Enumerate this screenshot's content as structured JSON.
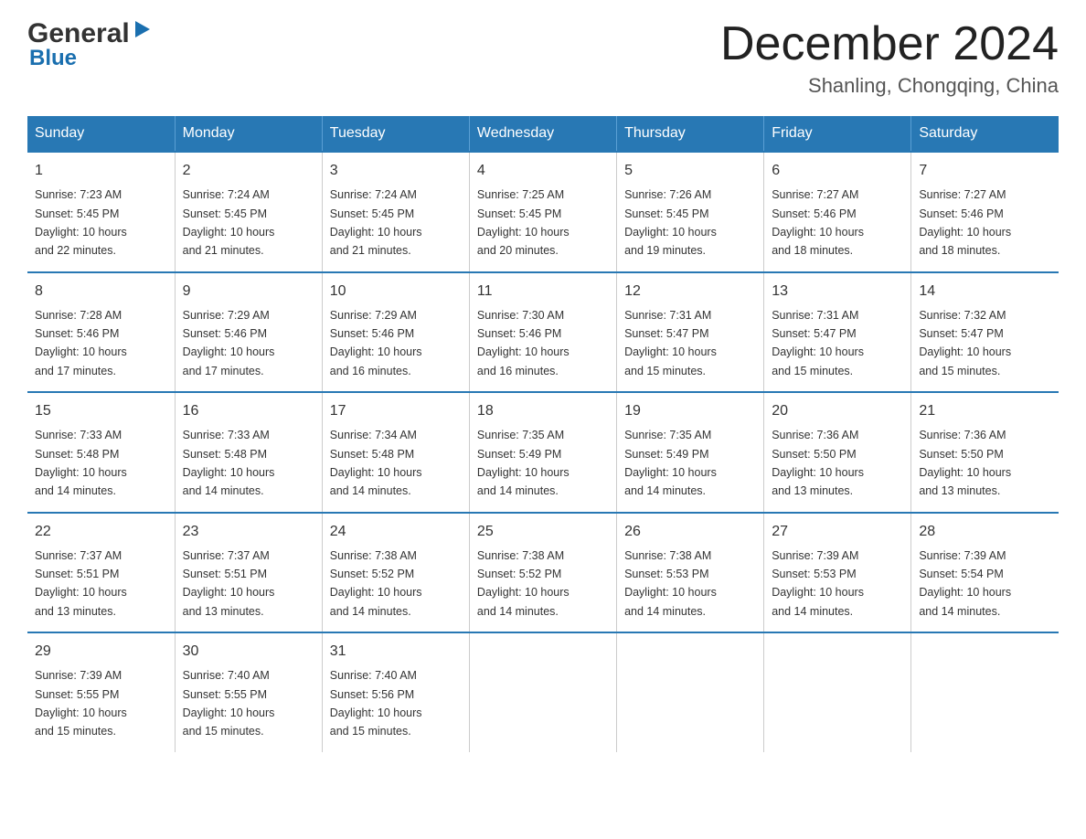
{
  "logo": {
    "general": "General",
    "blue": "Blue"
  },
  "title": "December 2024",
  "subtitle": "Shanling, Chongqing, China",
  "days": [
    "Sunday",
    "Monday",
    "Tuesday",
    "Wednesday",
    "Thursday",
    "Friday",
    "Saturday"
  ],
  "weeks": [
    [
      {
        "num": "1",
        "sunrise": "7:23 AM",
        "sunset": "5:45 PM",
        "daylight": "10 hours and 22 minutes."
      },
      {
        "num": "2",
        "sunrise": "7:24 AM",
        "sunset": "5:45 PM",
        "daylight": "10 hours and 21 minutes."
      },
      {
        "num": "3",
        "sunrise": "7:24 AM",
        "sunset": "5:45 PM",
        "daylight": "10 hours and 21 minutes."
      },
      {
        "num": "4",
        "sunrise": "7:25 AM",
        "sunset": "5:45 PM",
        "daylight": "10 hours and 20 minutes."
      },
      {
        "num": "5",
        "sunrise": "7:26 AM",
        "sunset": "5:45 PM",
        "daylight": "10 hours and 19 minutes."
      },
      {
        "num": "6",
        "sunrise": "7:27 AM",
        "sunset": "5:46 PM",
        "daylight": "10 hours and 18 minutes."
      },
      {
        "num": "7",
        "sunrise": "7:27 AM",
        "sunset": "5:46 PM",
        "daylight": "10 hours and 18 minutes."
      }
    ],
    [
      {
        "num": "8",
        "sunrise": "7:28 AM",
        "sunset": "5:46 PM",
        "daylight": "10 hours and 17 minutes."
      },
      {
        "num": "9",
        "sunrise": "7:29 AM",
        "sunset": "5:46 PM",
        "daylight": "10 hours and 17 minutes."
      },
      {
        "num": "10",
        "sunrise": "7:29 AM",
        "sunset": "5:46 PM",
        "daylight": "10 hours and 16 minutes."
      },
      {
        "num": "11",
        "sunrise": "7:30 AM",
        "sunset": "5:46 PM",
        "daylight": "10 hours and 16 minutes."
      },
      {
        "num": "12",
        "sunrise": "7:31 AM",
        "sunset": "5:47 PM",
        "daylight": "10 hours and 15 minutes."
      },
      {
        "num": "13",
        "sunrise": "7:31 AM",
        "sunset": "5:47 PM",
        "daylight": "10 hours and 15 minutes."
      },
      {
        "num": "14",
        "sunrise": "7:32 AM",
        "sunset": "5:47 PM",
        "daylight": "10 hours and 15 minutes."
      }
    ],
    [
      {
        "num": "15",
        "sunrise": "7:33 AM",
        "sunset": "5:48 PM",
        "daylight": "10 hours and 14 minutes."
      },
      {
        "num": "16",
        "sunrise": "7:33 AM",
        "sunset": "5:48 PM",
        "daylight": "10 hours and 14 minutes."
      },
      {
        "num": "17",
        "sunrise": "7:34 AM",
        "sunset": "5:48 PM",
        "daylight": "10 hours and 14 minutes."
      },
      {
        "num": "18",
        "sunrise": "7:35 AM",
        "sunset": "5:49 PM",
        "daylight": "10 hours and 14 minutes."
      },
      {
        "num": "19",
        "sunrise": "7:35 AM",
        "sunset": "5:49 PM",
        "daylight": "10 hours and 14 minutes."
      },
      {
        "num": "20",
        "sunrise": "7:36 AM",
        "sunset": "5:50 PM",
        "daylight": "10 hours and 13 minutes."
      },
      {
        "num": "21",
        "sunrise": "7:36 AM",
        "sunset": "5:50 PM",
        "daylight": "10 hours and 13 minutes."
      }
    ],
    [
      {
        "num": "22",
        "sunrise": "7:37 AM",
        "sunset": "5:51 PM",
        "daylight": "10 hours and 13 minutes."
      },
      {
        "num": "23",
        "sunrise": "7:37 AM",
        "sunset": "5:51 PM",
        "daylight": "10 hours and 13 minutes."
      },
      {
        "num": "24",
        "sunrise": "7:38 AM",
        "sunset": "5:52 PM",
        "daylight": "10 hours and 14 minutes."
      },
      {
        "num": "25",
        "sunrise": "7:38 AM",
        "sunset": "5:52 PM",
        "daylight": "10 hours and 14 minutes."
      },
      {
        "num": "26",
        "sunrise": "7:38 AM",
        "sunset": "5:53 PM",
        "daylight": "10 hours and 14 minutes."
      },
      {
        "num": "27",
        "sunrise": "7:39 AM",
        "sunset": "5:53 PM",
        "daylight": "10 hours and 14 minutes."
      },
      {
        "num": "28",
        "sunrise": "7:39 AM",
        "sunset": "5:54 PM",
        "daylight": "10 hours and 14 minutes."
      }
    ],
    [
      {
        "num": "29",
        "sunrise": "7:39 AM",
        "sunset": "5:55 PM",
        "daylight": "10 hours and 15 minutes."
      },
      {
        "num": "30",
        "sunrise": "7:40 AM",
        "sunset": "5:55 PM",
        "daylight": "10 hours and 15 minutes."
      },
      {
        "num": "31",
        "sunrise": "7:40 AM",
        "sunset": "5:56 PM",
        "daylight": "10 hours and 15 minutes."
      },
      null,
      null,
      null,
      null
    ]
  ],
  "labels": {
    "sunrise": "Sunrise:",
    "sunset": "Sunset:",
    "daylight": "Daylight:"
  }
}
